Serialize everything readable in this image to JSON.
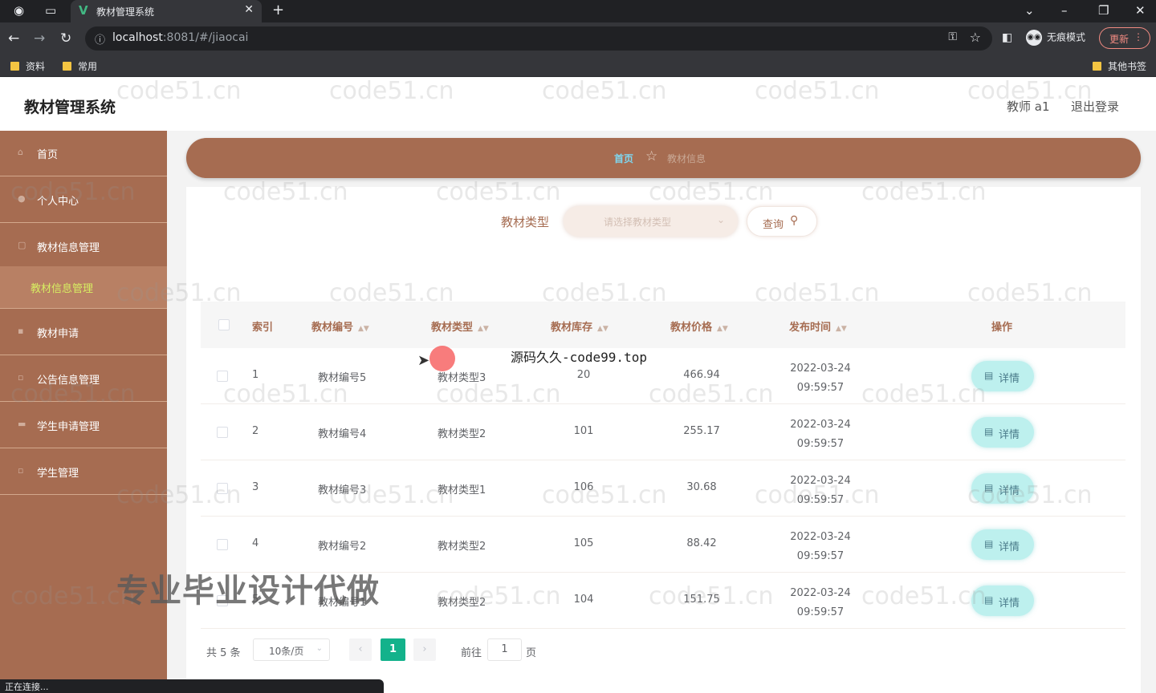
{
  "browser": {
    "tab_title": "教材管理系统",
    "url_host": "localhost",
    "url_rest": ":8081/#/jiaocai",
    "incognito_label": "无痕模式",
    "update_label": "更新",
    "bookmarks": [
      "资料",
      "常用"
    ],
    "other_bookmarks": "其他书签",
    "status_text": "正在连接..."
  },
  "header": {
    "title": "教材管理系统",
    "user": "教师 a1",
    "logout": "退出登录"
  },
  "sidebar": {
    "items": [
      {
        "label": "首页",
        "active": false
      },
      {
        "label": "个人中心",
        "active": false
      },
      {
        "label": "教材信息管理",
        "active": false
      },
      {
        "label": "教材信息管理",
        "active": true
      },
      {
        "label": "教材申请",
        "active": false
      },
      {
        "label": "公告信息管理",
        "active": false
      },
      {
        "label": "学生申请管理",
        "active": false
      },
      {
        "label": "学生管理",
        "active": false
      }
    ]
  },
  "breadcrumb": {
    "home": "首页",
    "current": "教材信息"
  },
  "filter": {
    "label": "教材类型",
    "placeholder": "请选择教材类型",
    "query_label": "查询"
  },
  "table": {
    "headers": [
      "索引",
      "教材编号",
      "教材类型",
      "教材库存",
      "教材价格",
      "发布时间",
      "操作"
    ],
    "rows": [
      {
        "idx": "1",
        "code": "教材编号5",
        "type": "教材类型3",
        "stock": "20",
        "price": "466.94",
        "date": "2022-03-24 09:59:57"
      },
      {
        "idx": "2",
        "code": "教材编号4",
        "type": "教材类型2",
        "stock": "101",
        "price": "255.17",
        "date": "2022-03-24 09:59:57"
      },
      {
        "idx": "3",
        "code": "教材编号3",
        "type": "教材类型1",
        "stock": "106",
        "price": "30.68",
        "date": "2022-03-24 09:59:57"
      },
      {
        "idx": "4",
        "code": "教材编号2",
        "type": "教材类型2",
        "stock": "105",
        "price": "88.42",
        "date": "2022-03-24 09:59:57"
      },
      {
        "idx": "5",
        "code": "教材编号1",
        "type": "教材类型2",
        "stock": "104",
        "price": "151.75",
        "date": "2022-03-24 09:59:57"
      }
    ],
    "detail_label": "详情"
  },
  "pagination": {
    "total": "共 5 条",
    "page_size": "10条/页",
    "current": "1",
    "goto_label": "前往",
    "goto_value": "1",
    "page_label": "页"
  },
  "overlays": {
    "watermark": "code51.cn",
    "code_text": "源码久久-code99.top",
    "ad_text": "专业毕业设计代做"
  }
}
